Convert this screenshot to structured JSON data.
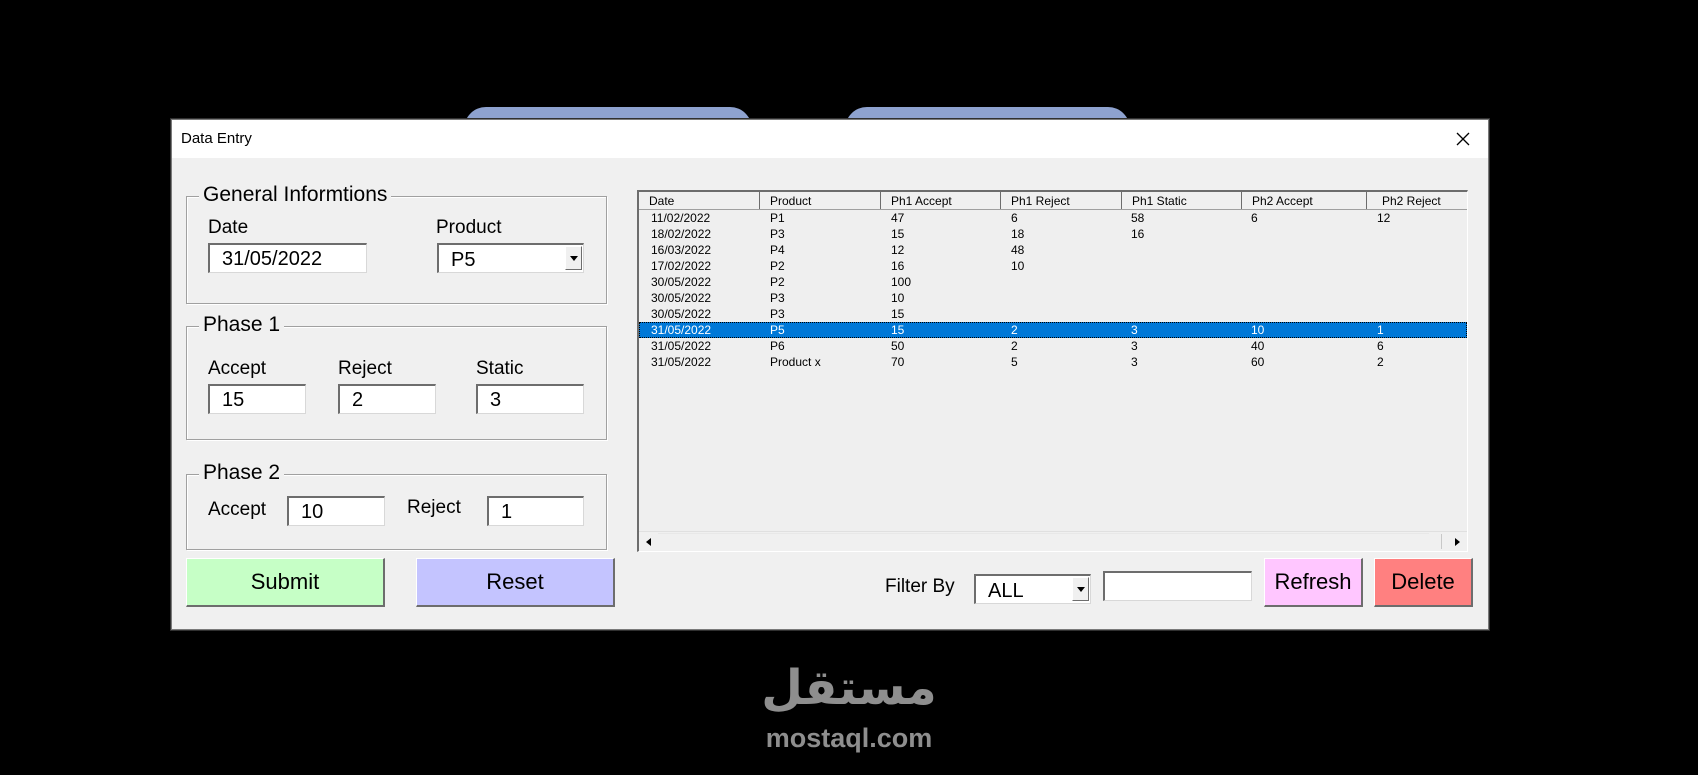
{
  "window": {
    "title": "Data Entry"
  },
  "general": {
    "legend": "General Informtions",
    "date_label": "Date",
    "date_value": "31/05/2022",
    "product_label": "Product",
    "product_value": "P5"
  },
  "phase1": {
    "legend": "Phase 1",
    "accept_label": "Accept",
    "accept_value": "15",
    "reject_label": "Reject",
    "reject_value": "2",
    "static_label": "Static",
    "static_value": "3"
  },
  "phase2": {
    "legend": "Phase 2",
    "accept_label": "Accept",
    "accept_value": "10",
    "reject_label": "Reject",
    "reject_value": "1"
  },
  "buttons": {
    "submit": "Submit",
    "reset": "Reset",
    "refresh": "Refresh",
    "delete": "Delete",
    "submit_color": "#c6ffc6",
    "reset_color": "#c4c4ff",
    "refresh_color": "#ffc6ff",
    "delete_color": "#ff8080"
  },
  "filter": {
    "label": "Filter By",
    "value": "ALL",
    "search_value": ""
  },
  "table": {
    "headers": [
      "Date",
      "Product",
      "Ph1 Accept",
      "Ph1 Reject",
      "Ph1 Static",
      "Ph2 Accept",
      "Ph2 Reject"
    ],
    "selected_index": 7,
    "selection_color": "#0078d7",
    "rows": [
      [
        "11/02/2022",
        "P1",
        "47",
        "6",
        "58",
        "6",
        "12"
      ],
      [
        "18/02/2022",
        "P3",
        "15",
        "18",
        "16",
        "",
        ""
      ],
      [
        "16/03/2022",
        "P4",
        "12",
        "48",
        "",
        "",
        ""
      ],
      [
        "17/02/2022",
        "P2",
        "16",
        "10",
        "",
        "",
        ""
      ],
      [
        "30/05/2022",
        "P2",
        "100",
        "",
        "",
        "",
        ""
      ],
      [
        "30/05/2022",
        "P3",
        "10",
        "",
        "",
        "",
        ""
      ],
      [
        "30/05/2022",
        "P3",
        "15",
        "",
        "",
        "",
        ""
      ],
      [
        "31/05/2022",
        "P5",
        "15",
        "2",
        "3",
        "10",
        "1"
      ],
      [
        "31/05/2022",
        "P6",
        "50",
        "2",
        "3",
        "40",
        "6"
      ],
      [
        "31/05/2022",
        "Product x",
        "70",
        "5",
        "3",
        "60",
        "2"
      ]
    ]
  },
  "watermark": {
    "arabic": "مستقل",
    "latin": "mostaql.com"
  }
}
